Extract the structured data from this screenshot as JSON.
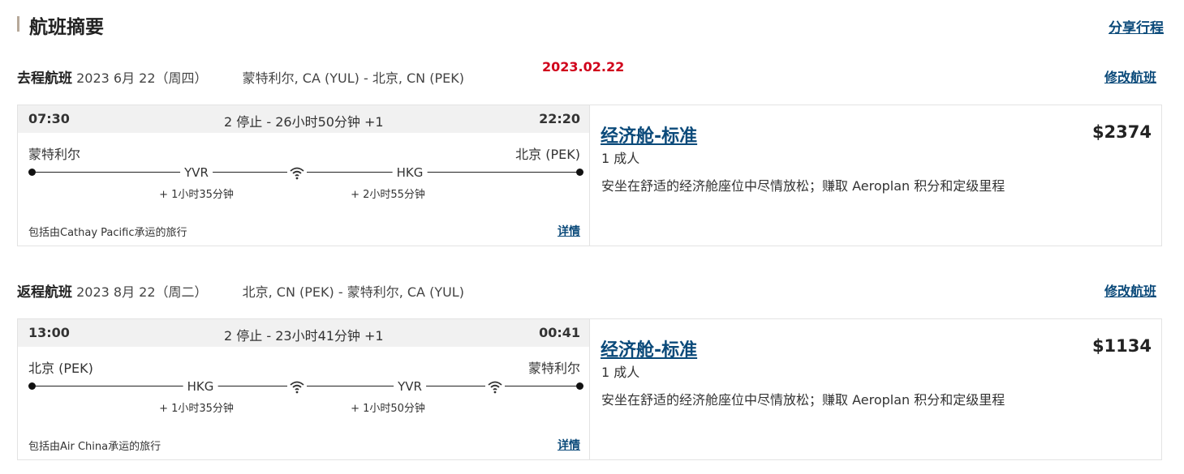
{
  "page": {
    "title": "航班摘要",
    "share_label": "分享行程",
    "date_stamp": "2023.02.22"
  },
  "outbound": {
    "label": "去程航班",
    "date": "2023 6月 22（周四）",
    "route": "蒙特利尔, CA (YUL) - 北京, CN (PEK)",
    "modify_label": "修改航班",
    "depart_time": "07:30",
    "summary": "2 停止 - 26小时50分钟 +1",
    "arrive_time": "22:20",
    "from_city": "蒙特利尔",
    "to_city": "北京 (PEK)",
    "stop1": "YVR",
    "stop2": "HKG",
    "layover1": "+ 1小时35分钟",
    "layover2": "+ 2小时55分钟",
    "operator": "包括由Cathay Pacific承运的旅行",
    "details_label": "详情",
    "fare_name": "经济舱-标准",
    "passengers": "1 成人",
    "fare_desc": "安坐在舒适的经济舱座位中尽情放松；赚取 Aeroplan 积分和定级里程",
    "price": "$2374",
    "wifi_segments": [
      "wifi-icon"
    ]
  },
  "return": {
    "label": "返程航班",
    "date": "2023 8月 22（周二）",
    "route": "北京, CN (PEK) - 蒙特利尔, CA (YUL)",
    "modify_label": "修改航班",
    "depart_time": "13:00",
    "summary": "2 停止 - 23小时41分钟 +1",
    "arrive_time": "00:41",
    "from_city": "北京 (PEK)",
    "to_city": "蒙特利尔",
    "stop1": "HKG",
    "stop2": "YVR",
    "layover1": "+ 1小时35分钟",
    "layover2": "+ 1小时50分钟",
    "operator": "包括由Air China承运的旅行",
    "details_label": "详情",
    "fare_name": "经济舱-标准",
    "passengers": "1 成人",
    "fare_desc": "安坐在舒适的经济舱座位中尽情放松；赚取 Aeroplan 积分和定级里程",
    "price": "$1134",
    "wifi_segments": [
      "wifi-icon",
      "wifi-icon"
    ]
  },
  "colors": {
    "link": "#0b4a7a",
    "stamp": "#d0021b",
    "strip_bg": "#f1f1f1"
  }
}
